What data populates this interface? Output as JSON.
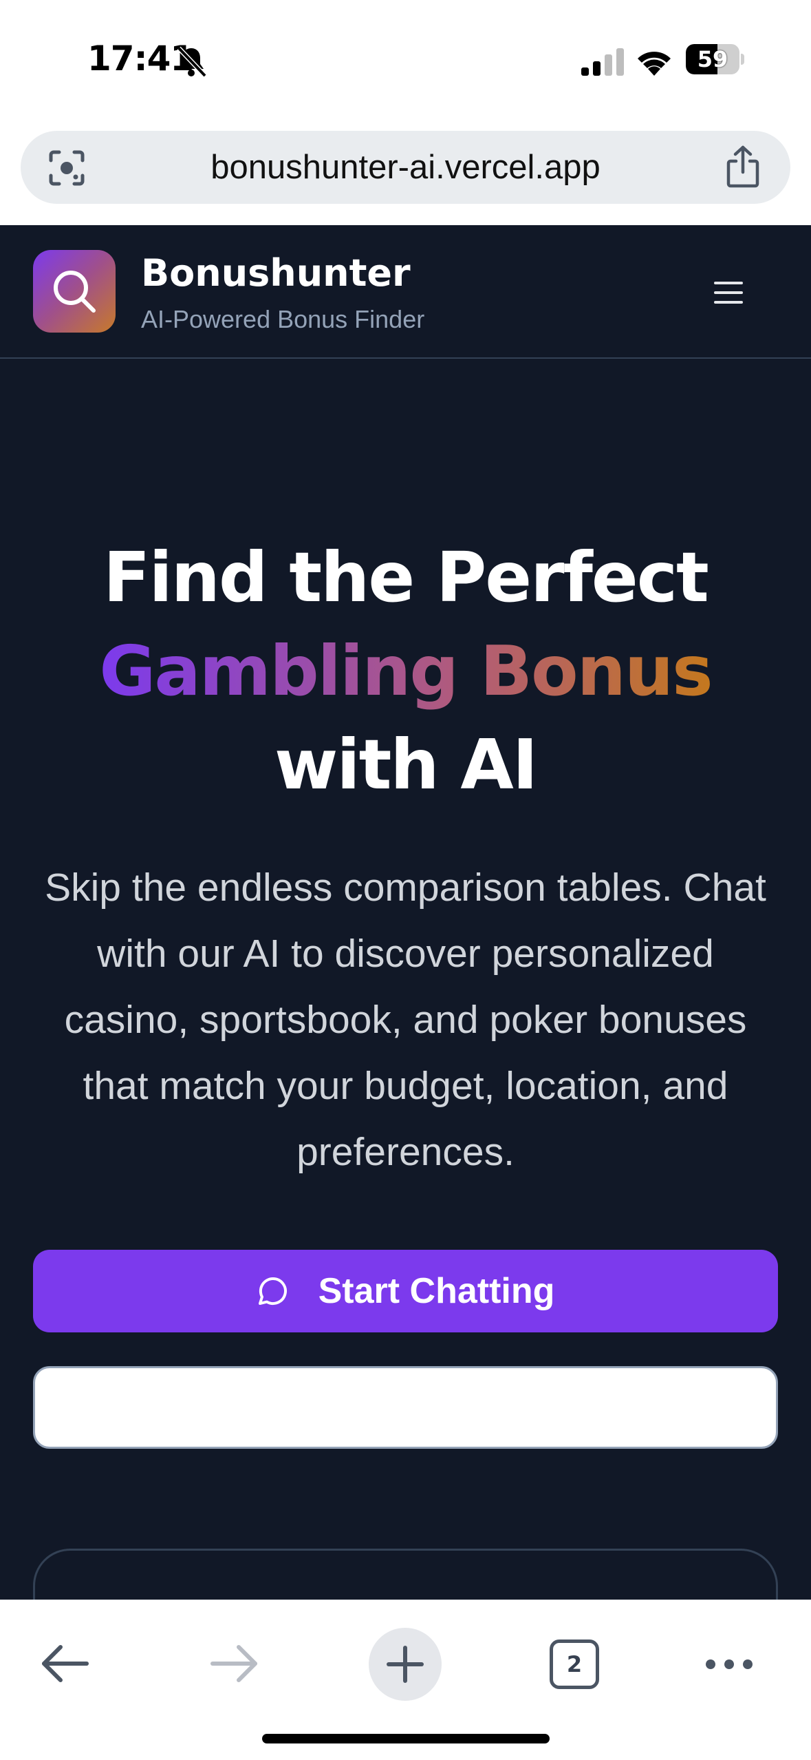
{
  "status_bar": {
    "time": "17:41",
    "battery": "59",
    "battery_level": 0.59
  },
  "browser": {
    "url": "bonushunter-ai.vercel.app",
    "tab_count": "2"
  },
  "header": {
    "brand": "Bonushunter",
    "tagline": "AI-Powered Bonus Finder"
  },
  "hero": {
    "title_part1": "Find the Perfect",
    "title_highlight": "Gambling Bonus",
    "title_part2": "with AI",
    "subtitle": "Skip the endless comparison tables. Chat with our AI to discover personalized casino, sportsbook, and poker bonuses that match your budget, location, and preferences.",
    "cta_label": "Start Chatting",
    "secondary_label": ""
  },
  "colors": {
    "page_bg": "#111827",
    "accent": "#7c3aed",
    "gradient_end": "#c4781e"
  },
  "icons": [
    "bell-slash-icon",
    "signal-icon",
    "wifi-icon",
    "lens-icon",
    "share-icon",
    "search-icon",
    "menu-icon",
    "chat-bubble-icon",
    "back-arrow-icon",
    "forward-arrow-icon",
    "plus-icon",
    "more-icon"
  ]
}
